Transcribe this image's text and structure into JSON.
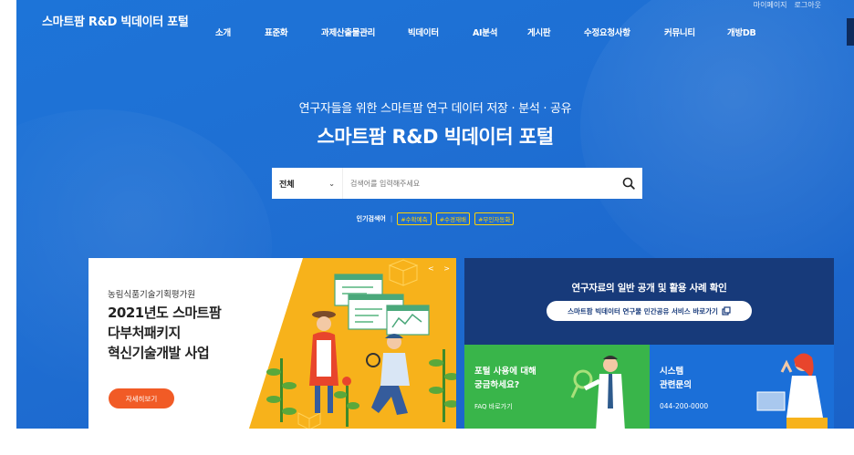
{
  "header": {
    "logo": "스마트팜 R&D 빅데이터 포털",
    "util": [
      "마이페이지",
      "로그아웃"
    ],
    "nav": [
      {
        "label": "소개"
      },
      {
        "label": "표준화"
      },
      {
        "label": "과제산출물관리"
      },
      {
        "label": "빅데이터"
      },
      {
        "label": "AI분석"
      },
      {
        "label": "게시판"
      },
      {
        "label": "수정요청사항"
      },
      {
        "label": "커뮤니티"
      },
      {
        "label": "개방DB"
      }
    ]
  },
  "hero": {
    "subtitle": "연구자들을 위한 스마트팜 연구 데이터 저장 · 분석 · 공유",
    "title": "스마트팜 R&D 빅데이터 포털"
  },
  "search": {
    "category": "전체",
    "placeholder": "검색어를 입력해주세요",
    "popular_label": "인기검색어",
    "tags": [
      "#수확예측",
      "#수경재배",
      "#무인자동화"
    ]
  },
  "banner": {
    "org": "농림식품기술기획평가원",
    "title_lines": [
      "2021년도 스마트팜",
      "다부처패키지",
      "혁신기술개발 사업"
    ],
    "button": "자세히보기",
    "pager": "< >"
  },
  "navy_panel": {
    "title": "연구자료의 일반 공개 및 활용 사례 확인",
    "button": "스마트팜 빅데이터 연구물 민간공유 서비스 바로가기"
  },
  "faq_panel": {
    "title_lines": [
      "포털 사용에 대해",
      "궁금하세요?"
    ],
    "link": "FAQ 바로가기"
  },
  "contact_panel": {
    "title_lines": [
      "시스템",
      "관련문의"
    ],
    "phone": "044-200-0000"
  },
  "colors": {
    "hero_blue": "#1f6fd3",
    "banner_yellow": "#f7b21b",
    "button_orange": "#f15b26",
    "navy": "#173a7a",
    "green": "#39b54a",
    "tag_yellow": "#ffd200"
  }
}
